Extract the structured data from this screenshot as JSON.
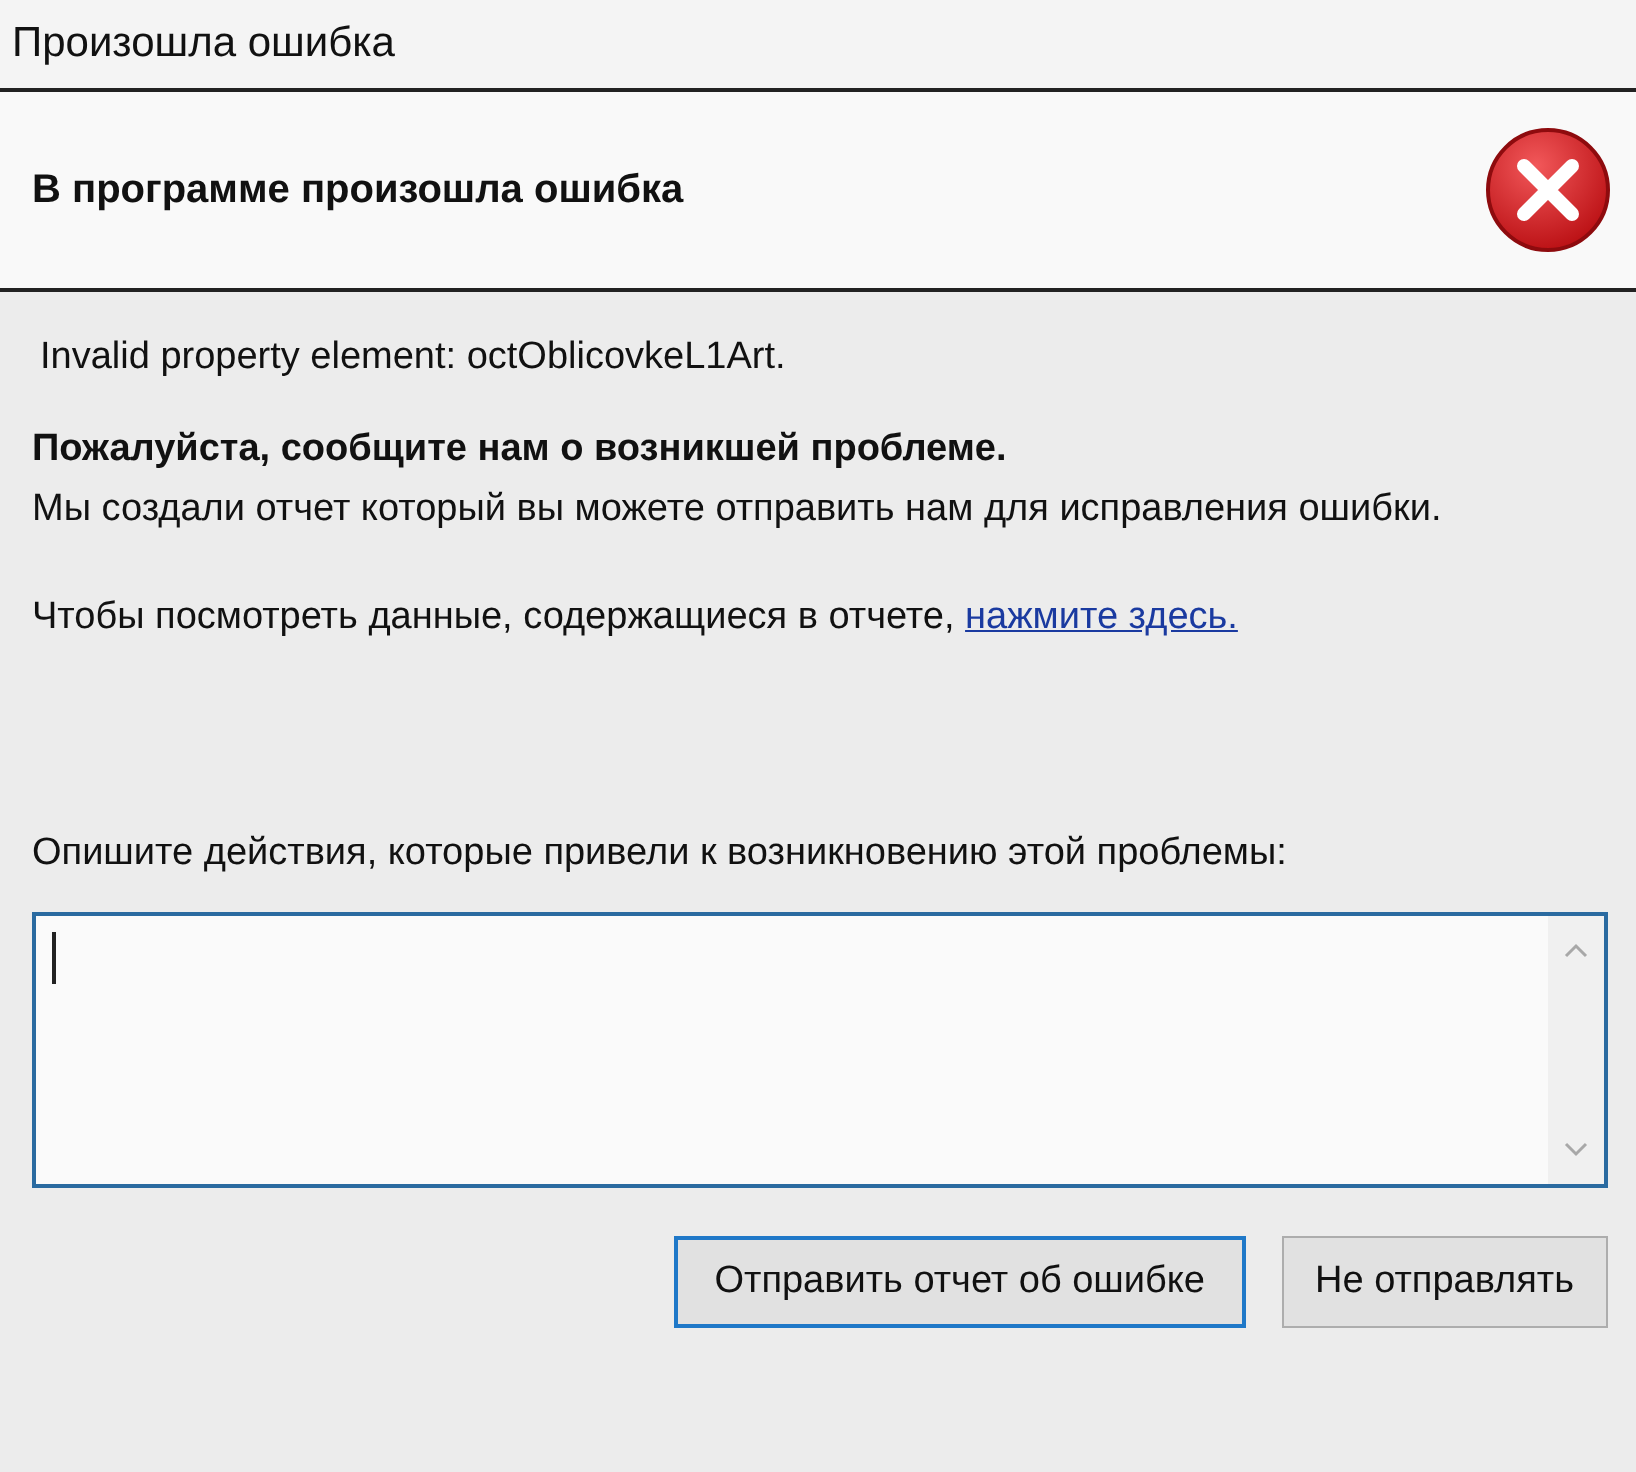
{
  "window": {
    "title": "Произошла ошибка"
  },
  "header": {
    "title": "В программе произошла ошибка"
  },
  "error_message": "Invalid property element: octOblicovkeL1Art.",
  "request": {
    "heading": "Пожалуйста, сообщите нам о возникшей проблеме.",
    "text": "Мы создали отчет который вы можете отправить нам для исправления ошибки."
  },
  "view_report": {
    "text": "Чтобы посмотреть данные, содержащиеся в отчете,",
    "link": "нажмите здесь."
  },
  "description": {
    "label": "Опишите действия, которые привели к возникновению этой проблемы:",
    "focused": true
  },
  "buttons": [
    {
      "label": "Отправить отчет об ошибке",
      "default": true
    },
    {
      "label": "Не отправлять",
      "default": false
    }
  ]
}
